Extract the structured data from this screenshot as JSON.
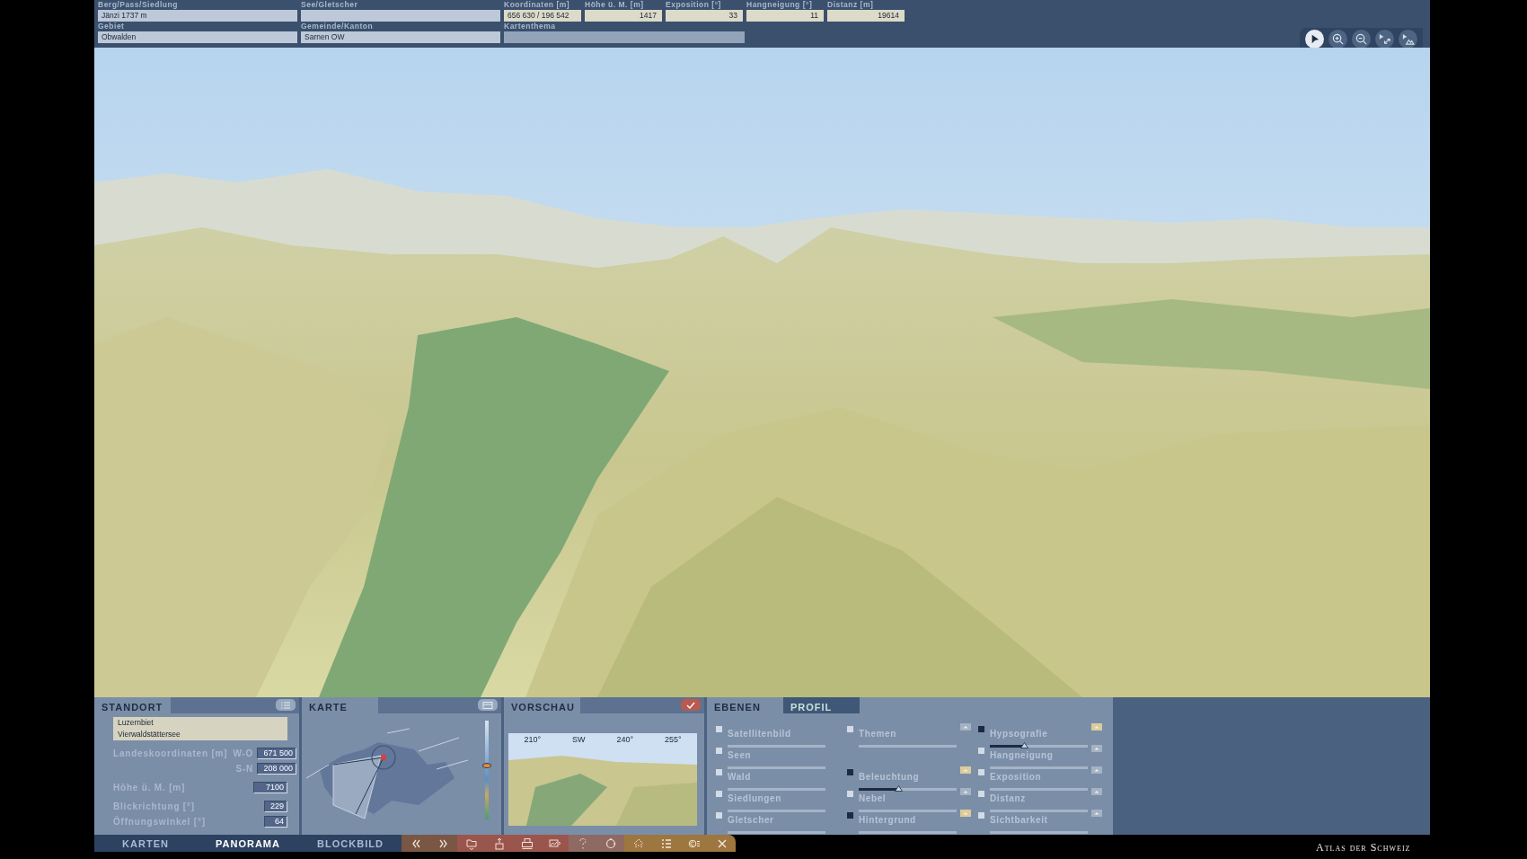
{
  "info_bar": {
    "rows": [
      [
        {
          "label": "Berg/Pass/Siedlung",
          "value": "Jänzi  1737 m",
          "kind": "wide"
        },
        {
          "label": "See/Gletscher",
          "kind": "wide"
        },
        {
          "label": "Koordinaten [m]",
          "value": "656 630 / 196 542",
          "kind": "tan"
        },
        {
          "label": "Höhe ü. M. [m]",
          "value": "1417",
          "kind": "tan-num"
        },
        {
          "label": "Exposition [°]",
          "value": "33",
          "kind": "tan-num"
        },
        {
          "label": "Hangneigung [°]",
          "value": "11",
          "kind": "tan-num"
        },
        {
          "label": "Distanz [m]",
          "value": "19614",
          "kind": "tan-num"
        }
      ],
      [
        {
          "label": "Gebiet",
          "value": "Obwalden",
          "kind": "wide"
        },
        {
          "label": "Gemeinde/Kanton",
          "value": "Sarnen  OW",
          "kind": "wide"
        },
        {
          "label": "Kartenthema",
          "kind": "double"
        }
      ]
    ]
  },
  "view_tools": [
    {
      "kind": "pointer",
      "selected": true
    },
    {
      "kind": "zoom-in",
      "selected": false
    },
    {
      "kind": "zoom-out",
      "selected": false
    },
    {
      "kind": "pointer-resize",
      "selected": false
    },
    {
      "kind": "pointer-landscape",
      "selected": false
    }
  ],
  "standort": {
    "title": "STANDORT",
    "places": [
      "Luzernbiet",
      "Vierwaldstättersee"
    ],
    "coords_label": "Landeskoordinaten [m]",
    "coords": [
      {
        "axis": "W-O",
        "value": "671 500"
      },
      {
        "axis": "S-N",
        "value": "208 000"
      }
    ],
    "fields": [
      {
        "label": "Höhe ü. M. [m]",
        "value": "7100"
      },
      {
        "label": "Blickrichtung [°]",
        "value": "229"
      },
      {
        "label": "Öffnungswinkel [°]",
        "value": "64"
      }
    ]
  },
  "karte": {
    "title": "KARTE",
    "zoom_slider": {
      "level": 0.55
    }
  },
  "vorschau": {
    "title": "VORSCHAU",
    "scale": [
      "210°",
      "SW",
      "240°",
      "255°"
    ]
  },
  "layers": {
    "tabs": [
      {
        "label": "EBENEN",
        "selected": true
      },
      {
        "label": "PROFIL",
        "selected": false
      }
    ],
    "columns": [
      [
        {
          "label": "Satellitenbild",
          "checked": false,
          "kind": "plain"
        },
        {
          "label": "Seen",
          "checked": false,
          "kind": "plain"
        },
        {
          "label": "Wald",
          "checked": false,
          "kind": "plain"
        },
        {
          "label": "Siedlungen",
          "checked": false,
          "kind": "plain"
        },
        {
          "label": "Gletscher",
          "checked": false,
          "kind": "plain"
        }
      ],
      [
        {
          "label": "Themen",
          "checked": false,
          "kind": "options"
        },
        null,
        {
          "label": "Beleuchtung",
          "checked": true,
          "kind": "options",
          "level": 0.4
        },
        {
          "label": "Nebel",
          "checked": false,
          "kind": "options"
        },
        {
          "label": "Hintergrund",
          "checked": true,
          "kind": "options"
        }
      ],
      [
        {
          "label": "Hypsografie",
          "checked": true,
          "kind": "options",
          "level": 0.35
        },
        {
          "label": "Hangneigung",
          "checked": false,
          "kind": "options"
        },
        {
          "label": "Exposition",
          "checked": false,
          "kind": "options"
        },
        {
          "label": "Distanz",
          "checked": false,
          "kind": "options"
        },
        {
          "label": "Sichtbarkeit",
          "checked": false,
          "kind": "options"
        }
      ]
    ]
  },
  "mode_tabs": [
    {
      "label": "KARTEN",
      "selected": false
    },
    {
      "label": "PANORAMA",
      "selected": true
    },
    {
      "label": "BLOCKBILD",
      "selected": false
    }
  ],
  "actions": [
    {
      "kind": "back"
    },
    {
      "kind": "forward"
    },
    {
      "kind": "open"
    },
    {
      "kind": "upload"
    },
    {
      "kind": "print"
    },
    {
      "kind": "image"
    },
    {
      "kind": "help"
    },
    {
      "kind": "rotate"
    },
    {
      "kind": "home"
    },
    {
      "kind": "list"
    },
    {
      "kind": "copyright"
    },
    {
      "kind": "close"
    }
  ],
  "brand": "Atlas der Schweiz"
}
